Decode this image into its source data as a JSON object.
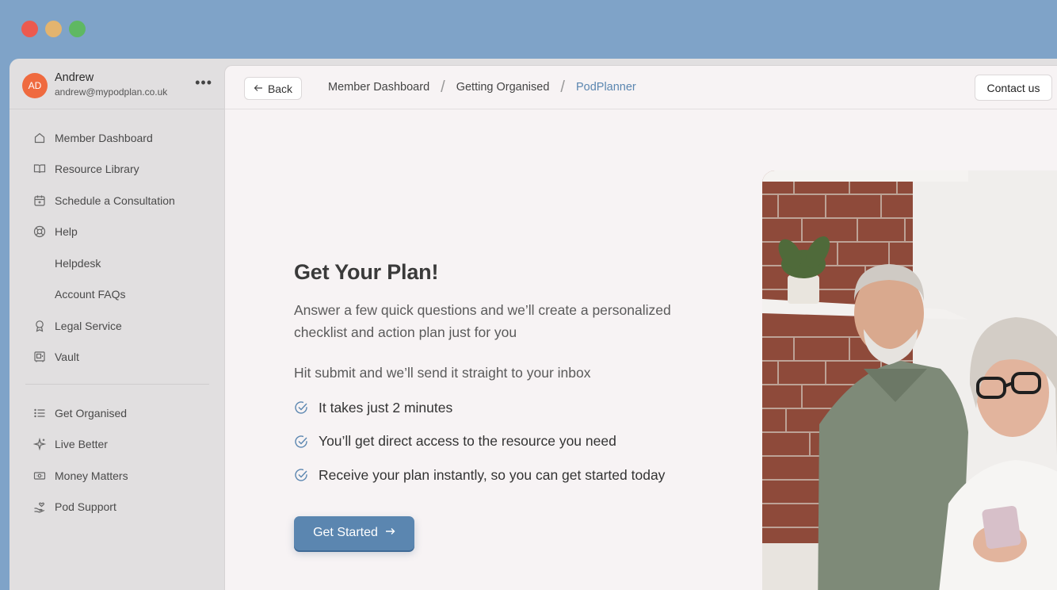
{
  "user": {
    "initials": "AD",
    "name": "Andrew",
    "email": "andrew@mypodplan.co.uk",
    "more_label": "•••"
  },
  "sidebar": {
    "items": [
      {
        "label": "Member Dashboard",
        "icon": "home-icon"
      },
      {
        "label": "Resource Library",
        "icon": "book-icon"
      },
      {
        "label": "Schedule a Consultation",
        "icon": "calendar-icon"
      },
      {
        "label": "Help",
        "icon": "lifebuoy-icon"
      },
      {
        "label": "Helpdesk",
        "icon": ""
      },
      {
        "label": "Account FAQs",
        "icon": ""
      },
      {
        "label": "Legal Service",
        "icon": "award-icon"
      },
      {
        "label": "Vault",
        "icon": "safe-icon"
      }
    ],
    "sections": [
      {
        "label": "Get Organised",
        "icon": "list-icon"
      },
      {
        "label": "Live Better",
        "icon": "sparkle-icon"
      },
      {
        "label": "Money Matters",
        "icon": "banknote-icon"
      },
      {
        "label": "Pod Support",
        "icon": "hand-heart-icon"
      }
    ]
  },
  "topbar": {
    "back_label": "Back",
    "breadcrumb": [
      "Member Dashboard",
      "Getting Organised",
      "PodPlanner"
    ],
    "separator": "/",
    "contact_label": "Contact us"
  },
  "hero": {
    "title": "Get Your Plan!",
    "subtitle": "Answer a few quick questions and we’ll create a personalized checklist and action plan just for you",
    "hint": "Hit submit and we’ll send it straight to your inbox",
    "checks": [
      "It takes just 2 minutes",
      "You’ll get direct access to the resource you need",
      "Receive your plan instantly, so you can get started today"
    ],
    "cta_label": "Get Started"
  },
  "colors": {
    "desktop": "#7fa3c8",
    "accent": "#5b86b0",
    "avatar": "#ef6a3f",
    "sidebar_bg": "#e1dfe0",
    "main_bg": "#f7f3f4"
  }
}
